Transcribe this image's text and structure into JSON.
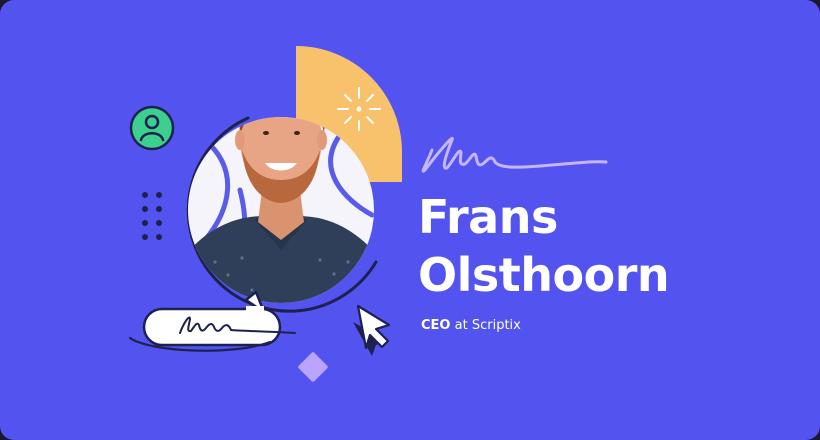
{
  "profile": {
    "first_name": "Frans",
    "last_name": "Olsthoorn",
    "role_title": "CEO",
    "role_connector": "at",
    "company": "Scriptix"
  },
  "colors": {
    "background": "#5353f0",
    "accent_yellow": "#f7c26b",
    "accent_green": "#3ccf8e",
    "accent_lilac": "#b9a4ff",
    "text": "#ffffff"
  },
  "icons": [
    "user-avatar-icon",
    "sparkle-icon",
    "cursor-arrow-icon",
    "diamond-shape",
    "signature-scribble"
  ]
}
